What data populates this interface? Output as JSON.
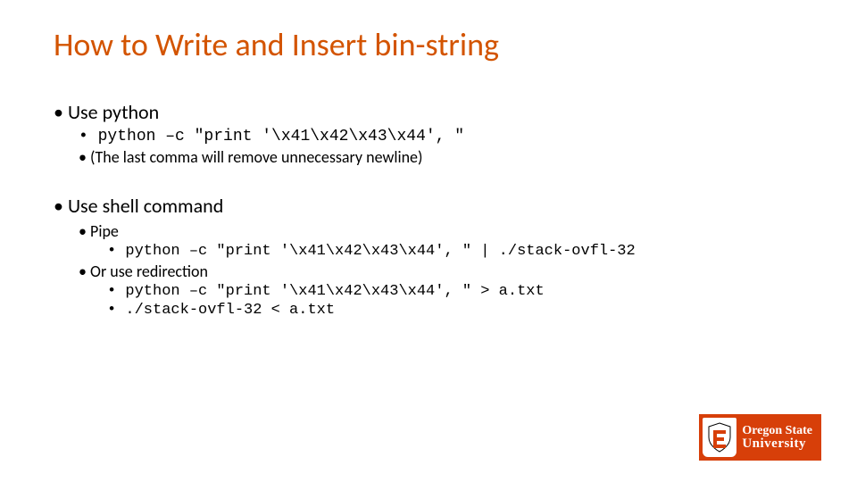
{
  "title": "How to Write and Insert bin-string",
  "bullets": {
    "b1": "Use python",
    "b1a": "python –c \"print '\\x41\\x42\\x43\\x44', \"",
    "b1b": "(The last comma will remove unnecessary newline)",
    "b2": "Use shell command",
    "b2a": "Pipe",
    "b2a1": "python –c \"print '\\x41\\x42\\x43\\x44', \" | ./stack-ovfl-32",
    "b2b": "Or use redirection",
    "b2b1": "python –c \"print '\\x41\\x42\\x43\\x44', \" > a.txt",
    "b2b2": "./stack-ovfl-32 < a.txt"
  },
  "logo": {
    "line1": "Oregon State",
    "line2": "University"
  }
}
